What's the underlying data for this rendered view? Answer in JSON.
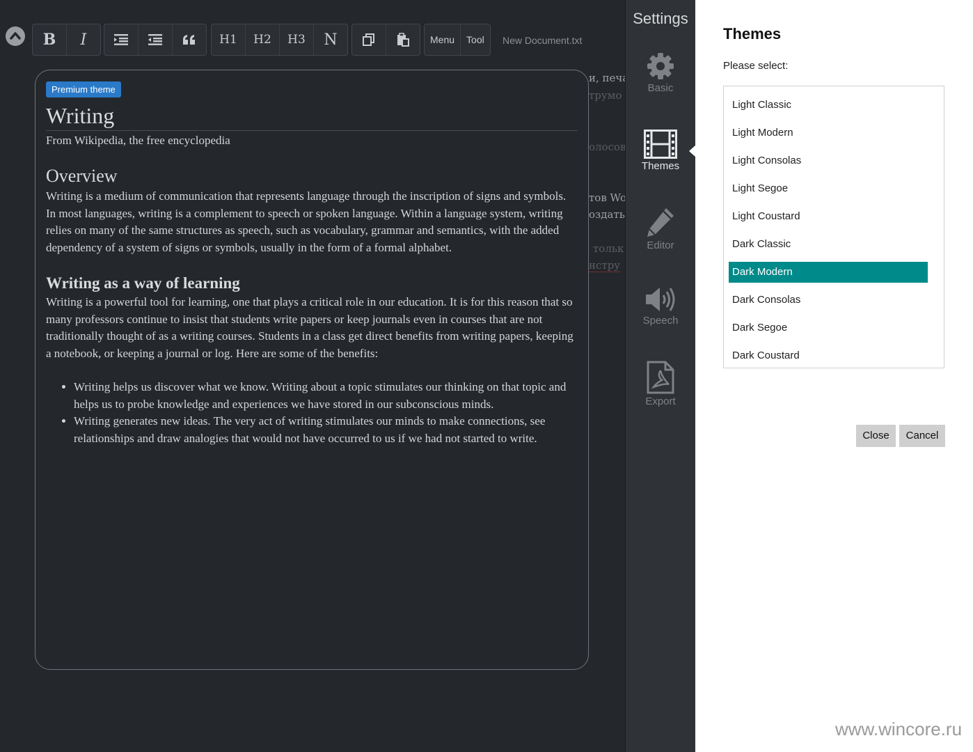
{
  "toolbar": {
    "bold": "B",
    "italic": "I",
    "h1": "H1",
    "h2": "H2",
    "h3": "H3",
    "normal": "N",
    "menu": "Menu",
    "tool": "Tool",
    "document_name": "New Document.txt"
  },
  "background_fragments": [
    "и, печа",
    "трумо",
    "олосов",
    "тов Wo",
    "оздать",
    "тольк",
    "нстру"
  ],
  "preview": {
    "badge": "Premium theme",
    "title": "Writing",
    "subtitle": "From Wikipedia, the free encyclopedia",
    "overview_heading": "Overview",
    "overview_text": "Writing is a medium of communication that represents language through the inscription of signs and symbols. In most languages, writing is a complement to speech or spoken language. Within a language system, writing relies on many of the same structures as speech, such as vocabulary, grammar and semantics, with the added dependency of a system of signs or symbols, usually in the form of a formal alphabet.",
    "learning_heading": "Writing as a way of learning",
    "learning_text": "Writing is a powerful tool for learning, one that plays a critical role in our education. It is for this reason that so many professors continue to insist that students write papers or keep journals even in courses that are not traditionally thought of as a writing courses. Students in a class get direct benefits from writing papers, keeping a notebook, or keeping a journal or log. Here are some of the benefits:",
    "bullets": [
      "Writing helps us discover what we know. Writing about a topic stimulates our thinking on that topic and helps us to probe knowledge and experiences we have stored in our subconscious minds.",
      "Writing generates new ideas. The very act of writing stimulates our minds to make connections, see relationships and draw analogies that would not have occurred to us if we had not started to write."
    ]
  },
  "settings": {
    "title": "Settings",
    "nav": [
      {
        "label": "Basic",
        "icon": "gear-icon"
      },
      {
        "label": "Themes",
        "icon": "film-icon"
      },
      {
        "label": "Editor",
        "icon": "pencil-icon"
      },
      {
        "label": "Speech",
        "icon": "speaker-icon"
      },
      {
        "label": "Export",
        "icon": "pdf-icon"
      }
    ],
    "active": "Themes"
  },
  "themes": {
    "title": "Themes",
    "prompt": "Please select:",
    "options": [
      "Light Classic",
      "Light Modern",
      "Light Consolas",
      "Light Segoe",
      "Light Coustard",
      "Dark Classic",
      "Dark Modern",
      "Dark Consolas",
      "Dark Segoe",
      "Dark Coustard"
    ],
    "selected": "Dark Modern",
    "selected_color": "#008a8a",
    "close_label": "Close",
    "cancel_label": "Cancel"
  },
  "watermark": "www.wincore.ru"
}
